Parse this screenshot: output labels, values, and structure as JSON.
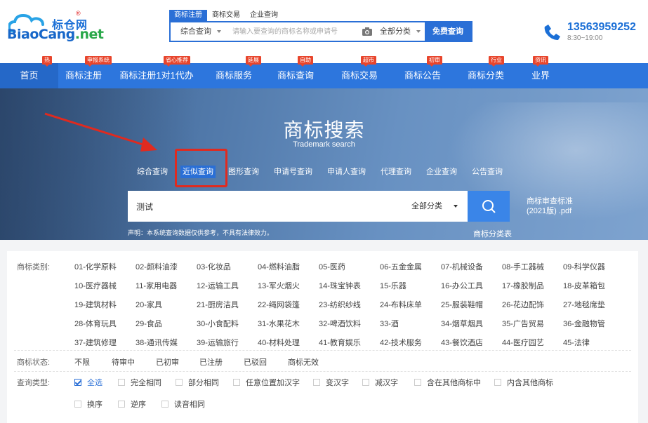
{
  "logo": {
    "brand_cn": "标仓网",
    "reg_mark": "®",
    "brand_en_a": "BiaoCang",
    "brand_en_b": ".net"
  },
  "top_search": {
    "tabs": [
      "商标注册",
      "商标交易",
      "企业查询"
    ],
    "type_select": "综合查询",
    "placeholder": "请输入要查询的商标名称或申请号",
    "category_select": "全部分类",
    "button": "免费查询",
    "camera_icon": "camera-icon"
  },
  "contact": {
    "phone": "13563959252",
    "hours": "8:30~19:00"
  },
  "nav": [
    {
      "label": "首页",
      "badge": "热"
    },
    {
      "label": "商标注册",
      "badge": "申报系统"
    },
    {
      "label": "商标注册1对1代办",
      "badge": "省心推荐"
    },
    {
      "label": "商标服务",
      "badge": "延展"
    },
    {
      "label": "商标查询",
      "badge": "自助"
    },
    {
      "label": "商标交易",
      "badge": "超市"
    },
    {
      "label": "商标公告",
      "badge": "初审"
    },
    {
      "label": "商标分类",
      "badge": "行业"
    },
    {
      "label": "业界",
      "badge": "资讯"
    }
  ],
  "hero": {
    "title": "商标搜索",
    "subtitle": "Trademark search",
    "search_types": [
      "综合查询",
      "近似查询",
      "图形查询",
      "申请号查询",
      "申请人查询",
      "代理查询",
      "企业查询",
      "公告查询"
    ],
    "active_type": "近似查询",
    "search_value": "测试",
    "category": "全部分类",
    "side_link_line1": "商标审查标准",
    "side_link_line2": "(2021版) .pdf",
    "side_link2": "商标分类表",
    "disclaimer": "声明：本系统查询数据仅供参考，不具有法律效力。"
  },
  "filters": {
    "category_label": "商标类别:",
    "categories": [
      "01-化学原料",
      "02-颜料油漆",
      "03-化妆品",
      "04-燃料油脂",
      "05-医药",
      "06-五金金属",
      "07-机械设备",
      "08-手工器械",
      "09-科学仪器",
      "10-医疗器械",
      "11-家用电器",
      "12-运输工具",
      "13-军火烟火",
      "14-珠宝钟表",
      "15-乐器",
      "16-办公工具",
      "17-橡胶制品",
      "18-皮革箱包",
      "19-建筑材料",
      "20-家具",
      "21-厨房洁具",
      "22-绳网袋篷",
      "23-纺织纱线",
      "24-布料床单",
      "25-服装鞋帽",
      "26-花边配饰",
      "27-地毯席垫",
      "28-体育玩具",
      "29-食品",
      "30-小食配料",
      "31-水果花木",
      "32-啤酒饮料",
      "33-酒",
      "34-烟草烟具",
      "35-广告贸易",
      "36-金融物管",
      "37-建筑修理",
      "38-通讯传媒",
      "39-运输旅行",
      "40-材料处理",
      "41-教育娱乐",
      "42-技术服务",
      "43-餐饮酒店",
      "44-医疗园艺",
      "45-法律"
    ],
    "status_label": "商标状态:",
    "statuses": [
      "不限",
      "待审中",
      "已初审",
      "已注册",
      "已驳回",
      "商标无效"
    ],
    "query_type_label": "查询类型:",
    "query_types": [
      "全选",
      "完全相同",
      "部分相同",
      "任意位置加汉字",
      "变汉字",
      "减汉字",
      "含在其他商标中",
      "内含其他商标",
      "换序",
      "逆序",
      "读音相同"
    ],
    "query_types_checked": [
      "全选"
    ]
  }
}
